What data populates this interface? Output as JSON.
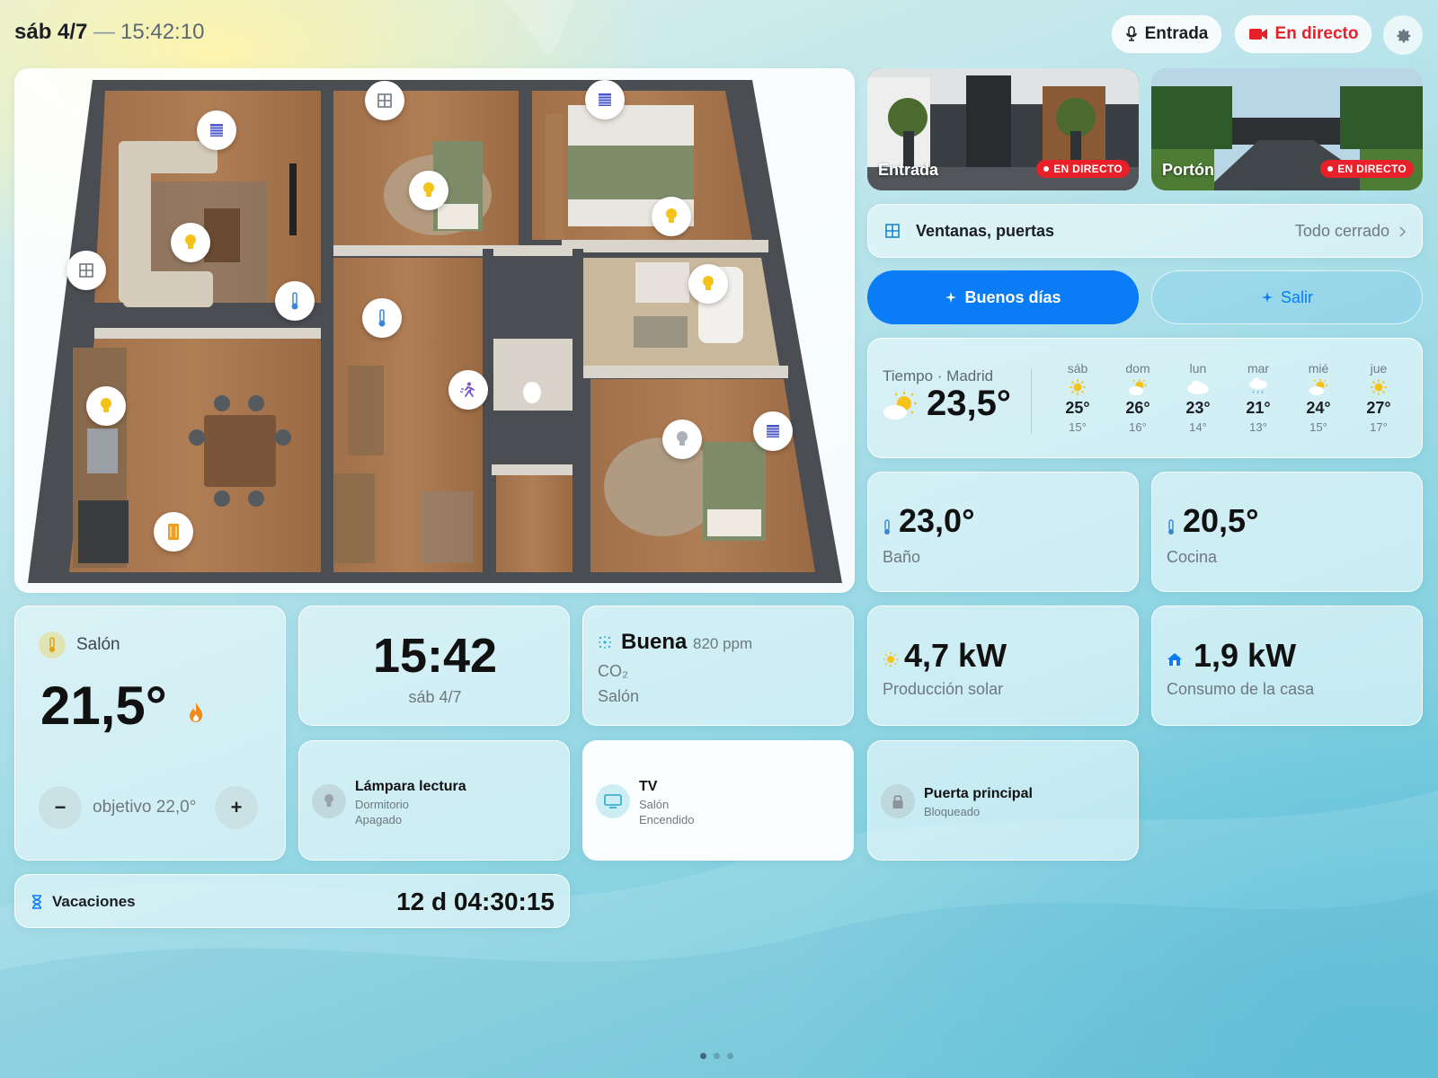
{
  "header": {
    "date": "sáb 4/7",
    "separator": "—",
    "time": "15:42:10",
    "btn_entrada": "Entrada",
    "btn_live": "En directo"
  },
  "floorplan": {
    "markers": [
      "shutter-icon",
      "window-icon",
      "shutter-icon",
      "bulb-icon",
      "bulb-icon",
      "window-icon",
      "bulb-icon",
      "thermometer-icon",
      "thermometer-icon",
      "bulb-icon",
      "motion-icon",
      "bulb-icon",
      "shutter-icon",
      "bulb-icon",
      "door-icon"
    ]
  },
  "cameras": [
    {
      "label": "Entrada",
      "badge": "EN DIRECTO"
    },
    {
      "label": "Portón",
      "badge": "EN DIRECTO"
    }
  ],
  "openings": {
    "label": "Ventanas, puertas",
    "status": "Todo cerrado"
  },
  "scenes": {
    "good_morning": "Buenos días",
    "leave": "Salir"
  },
  "weather": {
    "title": "Tiempo · Madrid",
    "current": "23,5°",
    "forecast": [
      {
        "day": "sáb",
        "high": "25°",
        "low": "15°",
        "icon": "sun-icon"
      },
      {
        "day": "dom",
        "high": "26°",
        "low": "16°",
        "icon": "partly-cloudy-icon"
      },
      {
        "day": "lun",
        "high": "23°",
        "low": "14°",
        "icon": "cloud-icon"
      },
      {
        "day": "mar",
        "high": "21°",
        "low": "13°",
        "icon": "rain-icon"
      },
      {
        "day": "mié",
        "high": "24°",
        "low": "15°",
        "icon": "partly-cloudy-icon"
      },
      {
        "day": "jue",
        "high": "27°",
        "low": "17°",
        "icon": "sun-icon"
      }
    ]
  },
  "temps": {
    "bano": {
      "value": "23,0°",
      "label": "Baño"
    },
    "cocina": {
      "value": "20,5°",
      "label": "Cocina"
    }
  },
  "thermostat": {
    "room": "Salón",
    "current": "21,5°",
    "target": "objetivo 22,0°",
    "minus": "−",
    "plus": "+"
  },
  "clock": {
    "time": "15:42",
    "date": "sáb 4/7"
  },
  "air": {
    "quality": "Buena",
    "ppm": "820 ppm",
    "gas": "CO₂",
    "room": "Salón"
  },
  "energy": {
    "solar": {
      "value": "4,7 kW",
      "label": "Producción solar"
    },
    "house": {
      "value": "1,9 kW",
      "label": "Consumo de la casa"
    }
  },
  "devices": {
    "lamp": {
      "name": "Lámpara lectura",
      "room": "Dormitorio",
      "state": "Apagado"
    },
    "tv": {
      "name": "TV",
      "room": "Salón",
      "state": "Encendido"
    },
    "door": {
      "name": "Puerta principal",
      "state": "Bloqueado"
    }
  },
  "vacation": {
    "label": "Vacaciones",
    "countdown": "12 d 04:30:15"
  },
  "colors": {
    "accent": "#0a7cf5",
    "live": "#e8202a",
    "bulb": "#f5c21a",
    "heat": "#f08a1c"
  }
}
